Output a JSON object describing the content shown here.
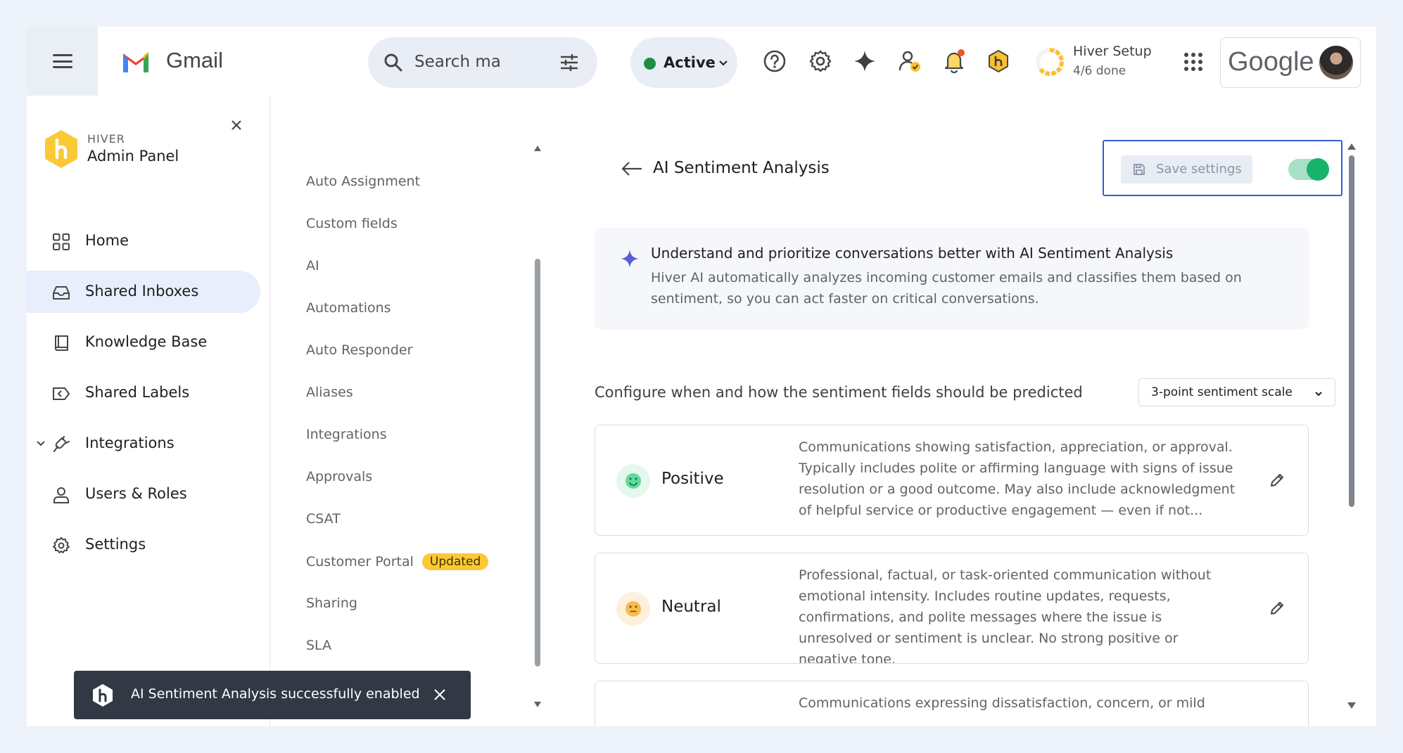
{
  "topbar": {
    "app_name": "Gmail",
    "search_placeholder": "Search ma",
    "status_label": "Active",
    "status_color": "#1e8e3e",
    "setup_title": "Hiver Setup",
    "setup_progress": "4/6 done",
    "setup_progress_fraction": 0.667,
    "account_brand": "Google",
    "icons": [
      "menu-icon",
      "search-icon",
      "filter-icon",
      "help-icon",
      "settings-gear-icon",
      "gemini-sparkle-icon",
      "user-check-icon",
      "notification-bell-icon",
      "hiver-extension-icon",
      "apps-grid-icon"
    ]
  },
  "sidebar": {
    "brand_sub": "HIVER",
    "brand_title": "Admin Panel",
    "items": [
      {
        "label": "Home",
        "icon": "grid-icon"
      },
      {
        "label": "Shared Inboxes",
        "icon": "inbox-icon",
        "selected": true
      },
      {
        "label": "Knowledge Base",
        "icon": "book-icon"
      },
      {
        "label": "Shared Labels",
        "icon": "label-icon"
      },
      {
        "label": "Integrations",
        "icon": "plug-icon",
        "expanded": true
      },
      {
        "label": "Users & Roles",
        "icon": "user-icon"
      },
      {
        "label": "Settings",
        "icon": "gear-icon"
      }
    ]
  },
  "submenu": {
    "items": [
      "Auto Assignment",
      "Custom fields",
      "AI",
      "Automations",
      "Auto Responder",
      "Aliases",
      "Integrations",
      "Approvals",
      "CSAT",
      "Customer Portal",
      "Sharing",
      "SLA"
    ],
    "badge": "Updated"
  },
  "main": {
    "title": "AI Sentiment Analysis",
    "save_label": "Save settings",
    "enabled": true,
    "accent_color": "#18b36b",
    "info_heading": "Understand and prioritize conversations better with AI Sentiment Analysis",
    "info_body": "Hiver AI automatically analyzes incoming customer emails and classifies them based on sentiment, so you can act faster on critical conversations.",
    "config_label": "Configure when and how the sentiment fields should be predicted",
    "scale_value": "3-point sentiment scale",
    "sentiments": [
      {
        "name": "Positive",
        "icon": "smile-face-icon",
        "color": "#34c77b",
        "description": "Communications showing satisfaction, appreciation, or approval. Typically includes polite or affirming language with signs of issue resolution or a good outcome. May also include acknowledgment of helpful service or productive engagement — even if not..."
      },
      {
        "name": "Neutral",
        "icon": "neutral-face-icon",
        "color": "#f2a93b",
        "description": "Professional, factual, or task-oriented communication without emotional intensity. Includes routine updates, requests, confirmations, and polite messages where the issue is unresolved or sentiment is unclear. No strong positive or negative tone."
      },
      {
        "name": "",
        "icon": "",
        "color": "",
        "description": "Communications expressing dissatisfaction, concern, or mild"
      }
    ]
  },
  "toast": {
    "message": "AI Sentiment Analysis successfully enabled"
  }
}
